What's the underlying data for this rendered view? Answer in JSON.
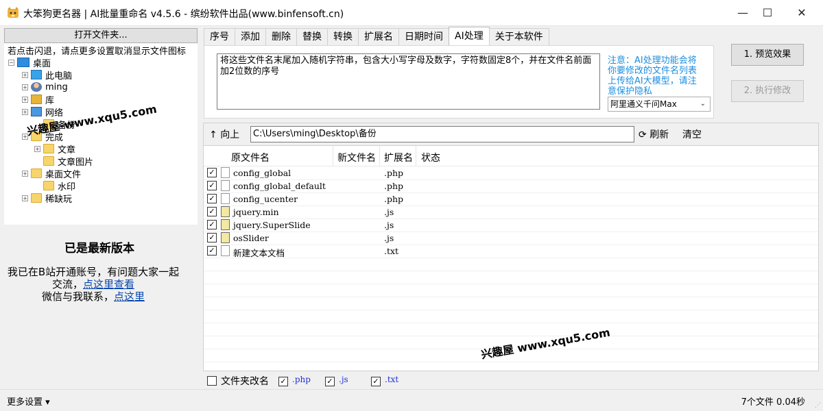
{
  "window": {
    "title": "大笨狗更名器 | AI批量重命名 v4.5.6 - 缤纷软件出品(www.binfensoft.cn)",
    "minimize": "—",
    "maximize": "☐",
    "close": "✕"
  },
  "left": {
    "open_folder": "打开文件夹...",
    "tree_hint": "若点击闪退，请点更多设置取消显示文件图标",
    "tree": [
      {
        "label": "桌面",
        "icon": "desktop-icon",
        "expander": "−"
      },
      {
        "label": "此电脑",
        "icon": "computer-icon",
        "expander": "+"
      },
      {
        "label": "ming",
        "icon": "user-icon",
        "expander": "+"
      },
      {
        "label": "库",
        "icon": "library-icon",
        "expander": "+"
      },
      {
        "label": "网络",
        "icon": "network-icon",
        "expander": "+"
      },
      {
        "label": "备份",
        "icon": "folder-icon",
        "expander": ""
      },
      {
        "label": "完成",
        "icon": "folder-icon",
        "expander": "+"
      },
      {
        "label": "文章",
        "icon": "folder-icon",
        "expander": "+"
      },
      {
        "label": "文章图片",
        "icon": "folder-icon",
        "expander": ""
      },
      {
        "label": "桌面文件",
        "icon": "folder-icon",
        "expander": "+"
      },
      {
        "label": "水印",
        "icon": "folder-icon",
        "expander": ""
      },
      {
        "label": "稀缺玩",
        "icon": "folder-icon",
        "expander": "+"
      }
    ],
    "version_status": "已是最新版本",
    "info_line1": "我已在B站开通账号，有问题大家一起交流，",
    "info_link1": "点这里查看",
    "info_line2": "微信与我联系，",
    "info_link2": "点这里"
  },
  "tabs": [
    "序号",
    "添加",
    "删除",
    "替换",
    "转换",
    "扩展名",
    "日期时间",
    "AI处理",
    "关于本软件"
  ],
  "active_tab": "AI处理",
  "ai": {
    "prompt": "将这些文件名末尾加入随机字符串，包含大小写字母及数字，字符数固定8个，并在文件名前面加2位数的序号",
    "note": "注意：AI处理功能会将你要修改的文件名列表上传给AI大模型，请注意保护隐私",
    "model": "阿里通义千问Max",
    "preview_button": "1. 预览效果",
    "execute_button": "2. 执行修改"
  },
  "path": {
    "up_label": "向上",
    "value": "C:\\Users\\ming\\Desktop\\备份",
    "refresh_label": "刷新",
    "clear_label": "清空"
  },
  "list": {
    "headers": [
      "原文件名",
      "新文件名",
      "扩展名",
      "状态"
    ],
    "rows": [
      {
        "checked": true,
        "name": "config_global",
        "ext": ".php",
        "icon": "php-file-icon"
      },
      {
        "checked": true,
        "name": "config_global_default",
        "ext": ".php",
        "icon": "php-file-icon"
      },
      {
        "checked": true,
        "name": "config_ucenter",
        "ext": ".php",
        "icon": "php-file-icon"
      },
      {
        "checked": true,
        "name": "jquery.min",
        "ext": ".js",
        "icon": "js-file-icon"
      },
      {
        "checked": true,
        "name": "jquery.SuperSlide",
        "ext": ".js",
        "icon": "js-file-icon"
      },
      {
        "checked": true,
        "name": "osSlider",
        "ext": ".js",
        "icon": "js-file-icon"
      },
      {
        "checked": true,
        "name": "新建文本文档",
        "ext": ".txt",
        "icon": "txt-file-icon"
      }
    ]
  },
  "filters": {
    "folder_rename_label": "文件夹改名",
    "folder_rename_checked": false,
    "exts": [
      {
        "label": ".php",
        "checked": true
      },
      {
        "label": ".js",
        "checked": true
      },
      {
        "label": ".txt",
        "checked": true
      }
    ]
  },
  "status": {
    "more_settings": "更多设置 ▾",
    "summary": "7个文件  0.04秒"
  },
  "watermarks": [
    "兴趣屋-www.xqu5.com",
    "兴趣屋 www.xqu5.com"
  ]
}
